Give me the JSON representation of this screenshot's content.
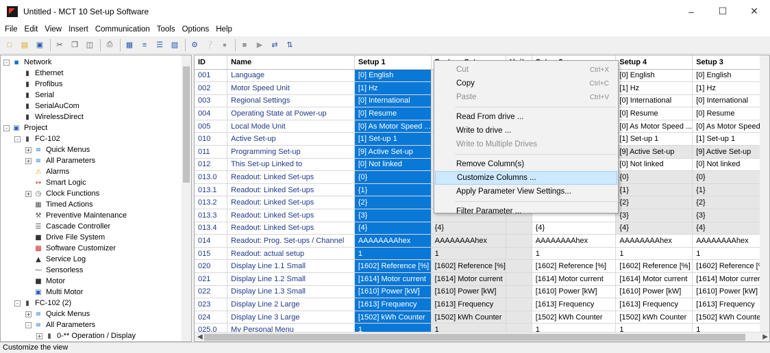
{
  "window": {
    "title": "Untitled - MCT 10 Set-up Software"
  },
  "menu": [
    "File",
    "Edit",
    "View",
    "Insert",
    "Communication",
    "Tools",
    "Options",
    "Help"
  ],
  "tree": [
    {
      "label": "Network",
      "level": 0,
      "icon": "network-icon",
      "exp": "-"
    },
    {
      "label": "Ethernet",
      "level": 1,
      "icon": "port-icon"
    },
    {
      "label": "Profibus",
      "level": 1,
      "icon": "port-icon"
    },
    {
      "label": "Serial",
      "level": 1,
      "icon": "port-icon"
    },
    {
      "label": "SerialAuCom",
      "level": 1,
      "icon": "port-icon"
    },
    {
      "label": "WirelessDirect",
      "level": 1,
      "icon": "port-icon"
    },
    {
      "label": "Project",
      "level": 0,
      "icon": "project-icon",
      "exp": "-"
    },
    {
      "label": "FC-102",
      "level": 1,
      "icon": "drive-icon",
      "exp": "-"
    },
    {
      "label": "Quick Menus",
      "level": 2,
      "icon": "list-icon",
      "exp": "+"
    },
    {
      "label": "All Parameters",
      "level": 2,
      "icon": "list-icon",
      "exp": "+"
    },
    {
      "label": "Alarms",
      "level": 2,
      "icon": "alarm-icon"
    },
    {
      "label": "Smart Logic",
      "level": 2,
      "icon": "logic-icon"
    },
    {
      "label": "Clock Functions",
      "level": 2,
      "icon": "clock-icon",
      "exp": "+"
    },
    {
      "label": "Timed Actions",
      "level": 2,
      "icon": "timed-icon"
    },
    {
      "label": "Preventive Maintenance",
      "level": 2,
      "icon": "wrench-icon"
    },
    {
      "label": "Cascade Controller",
      "level": 2,
      "icon": "cascade-icon"
    },
    {
      "label": "Drive File System",
      "level": 2,
      "icon": "file-icon"
    },
    {
      "label": "Software Customizer",
      "level": 2,
      "icon": "customizer-icon"
    },
    {
      "label": "Service Log",
      "level": 2,
      "icon": "log-icon"
    },
    {
      "label": "Sensorless",
      "level": 2,
      "icon": "sensor-icon"
    },
    {
      "label": "Motor",
      "level": 2,
      "icon": "motor-icon"
    },
    {
      "label": "Multi Motor",
      "level": 2,
      "icon": "multimotor-icon"
    },
    {
      "label": "FC-102 (2)",
      "level": 1,
      "icon": "drive-icon",
      "exp": "-"
    },
    {
      "label": "Quick Menus",
      "level": 2,
      "icon": "list-icon",
      "exp": "+"
    },
    {
      "label": "All Parameters",
      "level": 2,
      "icon": "list-icon",
      "exp": "-"
    },
    {
      "label": "0-** Operation / Display",
      "level": 3,
      "icon": "folder-icon",
      "exp": "+"
    }
  ],
  "columns": [
    "ID",
    "Name",
    "Setup 1",
    "Factory Setup",
    "Unit",
    "Setup 2",
    "Setup 4",
    "Setup 3"
  ],
  "rows": [
    [
      "001",
      "Language",
      "[0] English",
      "",
      "",
      "",
      "[0] English",
      "[0] English"
    ],
    [
      "002",
      "Motor Speed Unit",
      "[1] Hz",
      "",
      "",
      "",
      "[1] Hz",
      "[1] Hz"
    ],
    [
      "003",
      "Regional Settings",
      "[0] International",
      "",
      "",
      "",
      "[0] International",
      "[0] International"
    ],
    [
      "004",
      "Operating State at Power-up",
      "[0] Resume",
      "",
      "",
      "",
      "[0] Resume",
      "[0] Resume"
    ],
    [
      "005",
      "Local Mode Unit",
      "[0] As Motor Speed ...",
      "",
      "",
      "",
      "[0] As Motor Speed ...",
      "[0] As Motor Speed ..."
    ],
    [
      "010",
      "Active Set-up",
      "[1] Set-up 1",
      "",
      "",
      "",
      "[1] Set-up 1",
      "[1] Set-up 1"
    ],
    [
      "011",
      "Programming Set-up",
      "[9] Active Set-up",
      "",
      "",
      "",
      "[9] Active Set-up",
      "[9] Active Set-up"
    ],
    [
      "012",
      "This Set-up Linked to",
      "[0] Not linked",
      "",
      "",
      "",
      "[0] Not linked",
      "[0] Not linked"
    ],
    [
      "013.0",
      "Readout: Linked Set-ups",
      "{0}",
      "",
      "",
      "",
      "{0}",
      "{0}"
    ],
    [
      "013.1",
      "Readout: Linked Set-ups",
      "{1}",
      "",
      "",
      "",
      "{1}",
      "{1}"
    ],
    [
      "013.2",
      "Readout: Linked Set-ups",
      "{2}",
      "",
      "",
      "",
      "{2}",
      "{2}"
    ],
    [
      "013.3",
      "Readout: Linked Set-ups",
      "{3}",
      "",
      "",
      "",
      "{3}",
      "{3}"
    ],
    [
      "013.4",
      "Readout: Linked Set-ups",
      "{4}",
      "{4}",
      "",
      "{4}",
      "{4}",
      "{4}"
    ],
    [
      "014",
      "Readout: Prog. Set-ups / Channel",
      "AAAAAAAAhex",
      "AAAAAAAAhex",
      "",
      "AAAAAAAAhex",
      "AAAAAAAAhex",
      "AAAAAAAAhex"
    ],
    [
      "015",
      "Readout: actual setup",
      "1",
      "1",
      "",
      "1",
      "1",
      "1"
    ],
    [
      "020",
      "Display Line 1.1 Small",
      "[1602] Reference [%]",
      "[1602] Reference [%]",
      "",
      "[1602] Reference [%]",
      "[1602] Reference [%]",
      "[1602] Reference [%]"
    ],
    [
      "021",
      "Display Line 1.2 Small",
      "[1614] Motor current",
      "[1614] Motor current",
      "",
      "[1614] Motor current",
      "[1614] Motor current",
      "[1614] Motor current"
    ],
    [
      "022",
      "Display Line 1.3 Small",
      "[1610] Power [kW]",
      "[1610] Power [kW]",
      "",
      "[1610] Power [kW]",
      "[1610] Power [kW]",
      "[1610] Power [kW]"
    ],
    [
      "023",
      "Display Line 2 Large",
      "[1613] Frequency",
      "[1613] Frequency",
      "",
      "[1613] Frequency",
      "[1613] Frequency",
      "[1613] Frequency"
    ],
    [
      "024",
      "Display Line 3 Large",
      "[1502] kWh Counter",
      "[1502] kWh Counter",
      "",
      "[1502] kWh Counter",
      "[1502] kWh Counter",
      "[1502] kWh Counter"
    ],
    [
      "025.0",
      "My Personal Menu",
      "1",
      "1",
      "",
      "1",
      "1",
      "1"
    ]
  ],
  "context_menu": [
    {
      "label": "Cut",
      "shortcut": "Ctrl+X",
      "disabled": true
    },
    {
      "label": "Copy",
      "shortcut": "Ctrl+C",
      "disabled": false
    },
    {
      "label": "Paste",
      "shortcut": "Ctrl+V",
      "disabled": true
    },
    {
      "sep": true
    },
    {
      "label": "Read From drive ...",
      "shortcut": "",
      "disabled": false
    },
    {
      "label": "Write to drive ...",
      "shortcut": "",
      "disabled": false
    },
    {
      "label": "Write to Multiple Drives",
      "shortcut": "",
      "disabled": true
    },
    {
      "sep": true
    },
    {
      "label": "Remove Column(s)",
      "shortcut": "",
      "disabled": false
    },
    {
      "label": "Customize Columns ...",
      "shortcut": "",
      "disabled": false,
      "highlight": true
    },
    {
      "label": "Apply Parameter View Settings...",
      "shortcut": "",
      "disabled": false
    },
    {
      "sep": true
    },
    {
      "label": "Filter Parameter ...",
      "shortcut": "",
      "disabled": false
    }
  ],
  "status": "Customize the view"
}
